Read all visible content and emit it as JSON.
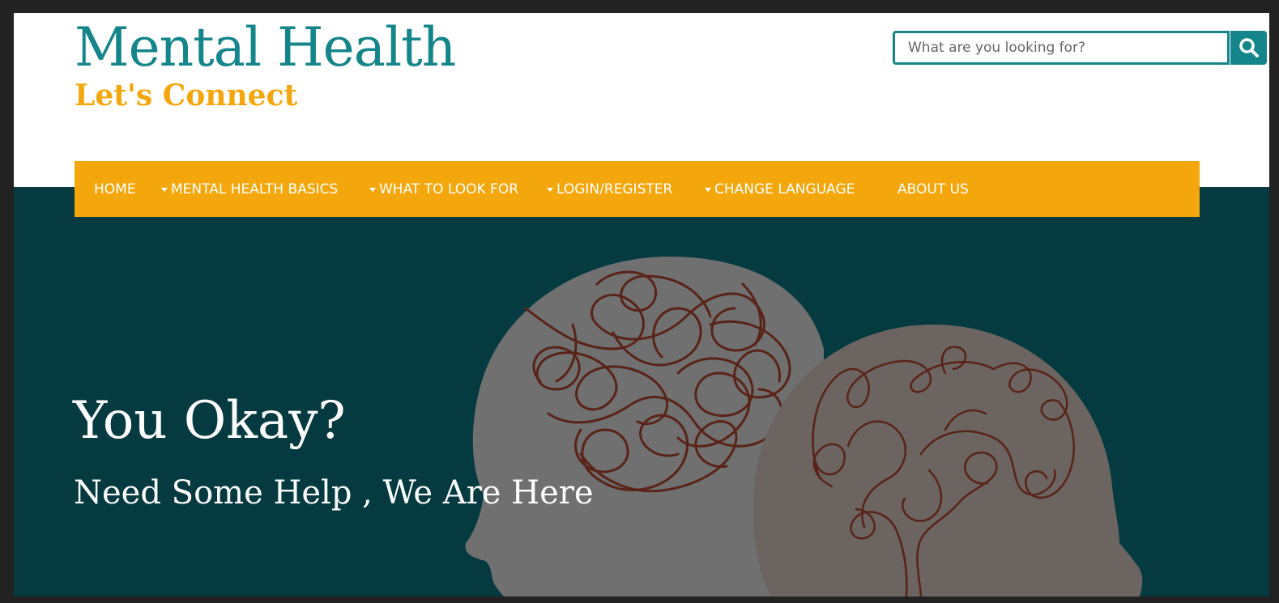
{
  "site": {
    "title": "Mental Health",
    "tagline": "Let's Connect"
  },
  "search": {
    "placeholder": "What are you looking for?",
    "value": "",
    "button_icon": "search-icon"
  },
  "nav": {
    "items": [
      {
        "label": "HOME",
        "has_dropdown": false
      },
      {
        "label": "MENTAL HEALTH BASICS",
        "has_dropdown": true
      },
      {
        "label": "WHAT TO LOOK FOR",
        "has_dropdown": true
      },
      {
        "label": "LOGIN/REGISTER",
        "has_dropdown": true
      },
      {
        "label": "CHANGE LANGUAGE",
        "has_dropdown": true
      },
      {
        "label": "ABOUT US",
        "has_dropdown": false
      }
    ]
  },
  "hero": {
    "heading": "You Okay?",
    "subheading": "Need Some Help , We Are Here"
  },
  "colors": {
    "brand_teal": "#14858a",
    "accent_orange": "#f4a70c",
    "hero_background": "#053b40",
    "head_gray": "#707070",
    "head_taupe": "#6b6460",
    "brain_line": "#5a2318"
  }
}
